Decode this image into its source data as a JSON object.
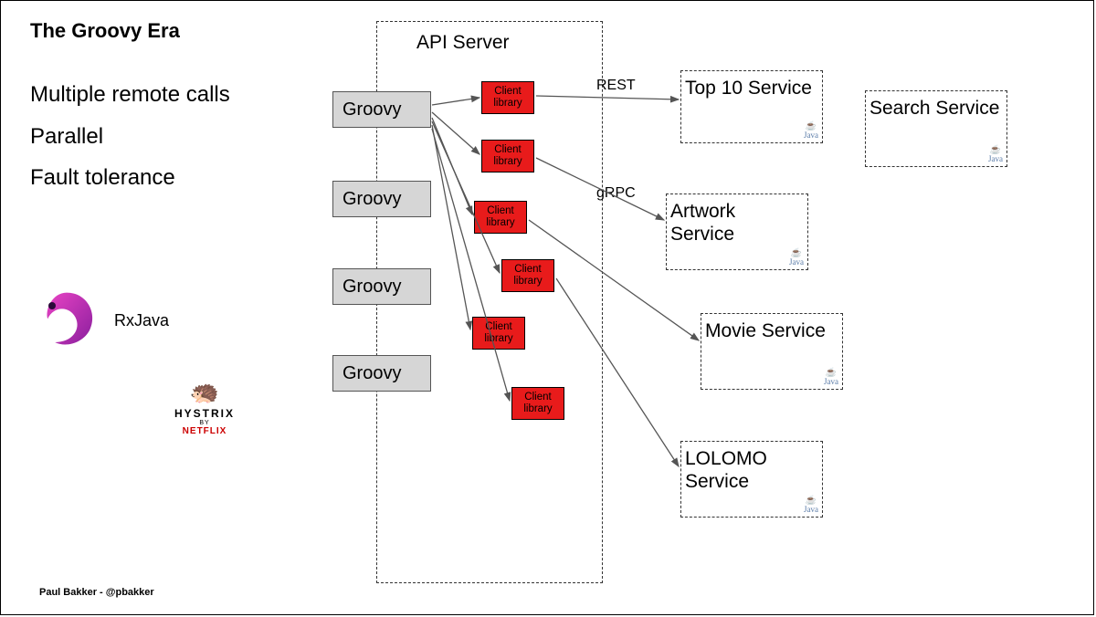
{
  "title": "The Groovy Era",
  "bullets": {
    "b1": "Multiple remote calls",
    "b2": "Parallel",
    "b3": "Fault tolerance"
  },
  "rxjava": {
    "label": "RxJava"
  },
  "hystrix": {
    "name": "HYSTRIX",
    "by": "BY",
    "brand": "NETFLIX"
  },
  "footer": "Paul Bakker - @pbakker",
  "api_server": {
    "label": "API Server"
  },
  "groovy": {
    "g1": "Groovy",
    "g2": "Groovy",
    "g3": "Groovy",
    "g4": "Groovy"
  },
  "client": {
    "c1": "Client library",
    "c2": "Client library",
    "c3": "Client library",
    "c4": "Client library",
    "c5": "Client library",
    "c6": "Client library"
  },
  "protocols": {
    "rest": "REST",
    "grpc": "gRPC"
  },
  "services": {
    "top10": "Top 10 Service",
    "artwork": "Artwork Service",
    "movie": "Movie Service",
    "lolomo": "LOLOMO Service",
    "search": "Search Service"
  },
  "java_badge": "Java"
}
